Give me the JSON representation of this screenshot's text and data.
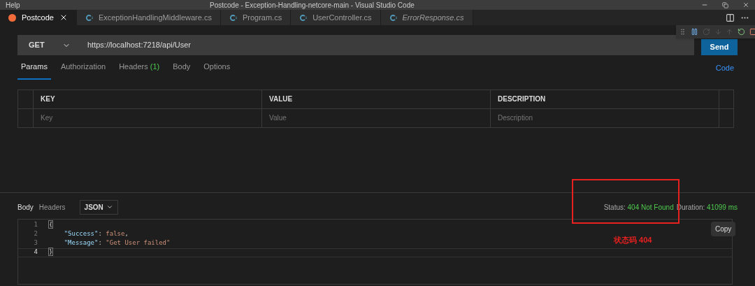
{
  "menu_bar": {
    "items": [
      "Help"
    ],
    "title": "Postcode - Exception-Handling-netcore-main - Visual Studio Code"
  },
  "editor_tabs": [
    {
      "label": "Postcode",
      "kind": "app",
      "selected": true,
      "italic": false
    },
    {
      "label": "ExceptionHandlingMiddleware.cs",
      "kind": "csharp",
      "selected": false,
      "italic": false
    },
    {
      "label": "Program.cs",
      "kind": "csharp",
      "selected": false,
      "italic": false
    },
    {
      "label": "UserController.cs",
      "kind": "csharp",
      "selected": false,
      "italic": false
    },
    {
      "label": "ErrorResponse.cs",
      "kind": "csharp",
      "selected": false,
      "italic": true
    }
  ],
  "request": {
    "method": "GET",
    "url": "https://localhost:7218/api/User",
    "send": "Send"
  },
  "request_tabs": [
    {
      "label": "Params",
      "selected": true
    },
    {
      "label": "Authorization",
      "selected": false
    },
    {
      "label": "Headers",
      "count": "(1)",
      "selected": false
    },
    {
      "label": "Body",
      "selected": false
    },
    {
      "label": "Options",
      "selected": false
    }
  ],
  "code_link": "Code",
  "params_table": {
    "columns": [
      "KEY",
      "VALUE",
      "DESCRIPTION"
    ],
    "placeholders": [
      "Key",
      "Value",
      "Description"
    ]
  },
  "response": {
    "tabs": [
      {
        "label": "Body",
        "selected": true
      },
      {
        "label": "Headers",
        "selected": false
      }
    ],
    "format": "JSON",
    "status_label": "Status:",
    "status": "404 Not Found",
    "duration_label": "Duration:",
    "duration": "41099 ms",
    "copy": "Copy",
    "lines": [
      {
        "number": "1",
        "current": false,
        "tokens": [
          {
            "kind": "bracket",
            "text": "{"
          }
        ]
      },
      {
        "number": "2",
        "current": false,
        "tokens": [
          {
            "kind": "key",
            "text": "\"Success\""
          },
          {
            "kind": "punct",
            "text": ": "
          },
          {
            "kind": "value",
            "text": "false"
          },
          {
            "kind": "punct",
            "text": ","
          }
        ]
      },
      {
        "number": "3",
        "current": false,
        "tokens": [
          {
            "kind": "key",
            "text": "\"Message\""
          },
          {
            "kind": "punct",
            "text": ": "
          },
          {
            "kind": "value",
            "text": "\"Get User failed\""
          }
        ]
      },
      {
        "number": "4",
        "current": true,
        "tokens": [
          {
            "kind": "bracket",
            "text": "}"
          }
        ]
      }
    ]
  },
  "annotation": {
    "text": "状态码 404"
  }
}
